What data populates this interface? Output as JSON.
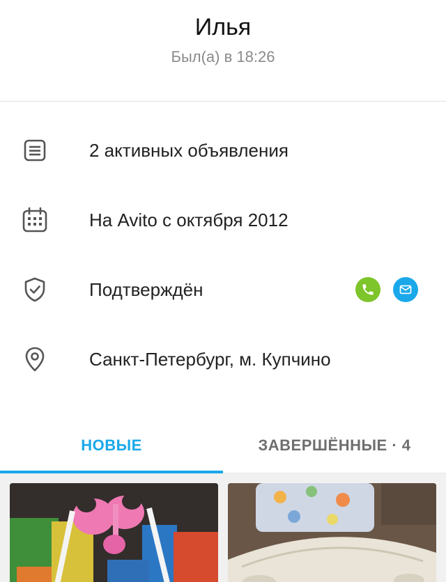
{
  "profile": {
    "name": "Илья",
    "last_seen": "Был(а) в 18:26"
  },
  "info_rows": [
    {
      "icon": "listings-icon",
      "text": "2 активных объявления"
    },
    {
      "icon": "calendar-icon",
      "text": "На Avito с октября 2012"
    },
    {
      "icon": "shield-check-icon",
      "text": "Подтверждён"
    },
    {
      "icon": "location-pin-icon",
      "text": "Санкт-Петербург, м. Купчино"
    }
  ],
  "verified_contacts": [
    {
      "icon": "phone-icon",
      "color": "#7ec42b"
    },
    {
      "icon": "mail-icon",
      "color": "#1aa8ea"
    }
  ],
  "tabs": [
    {
      "label": "НОВЫЕ",
      "active": true
    },
    {
      "label": "ЗАВЕРШЁННЫЕ · 4",
      "active": false
    }
  ],
  "colors": {
    "accent": "#1aa8ea",
    "phone_green": "#7ec42b",
    "muted_text": "#8a8a8a",
    "icon_gray": "#555555"
  }
}
